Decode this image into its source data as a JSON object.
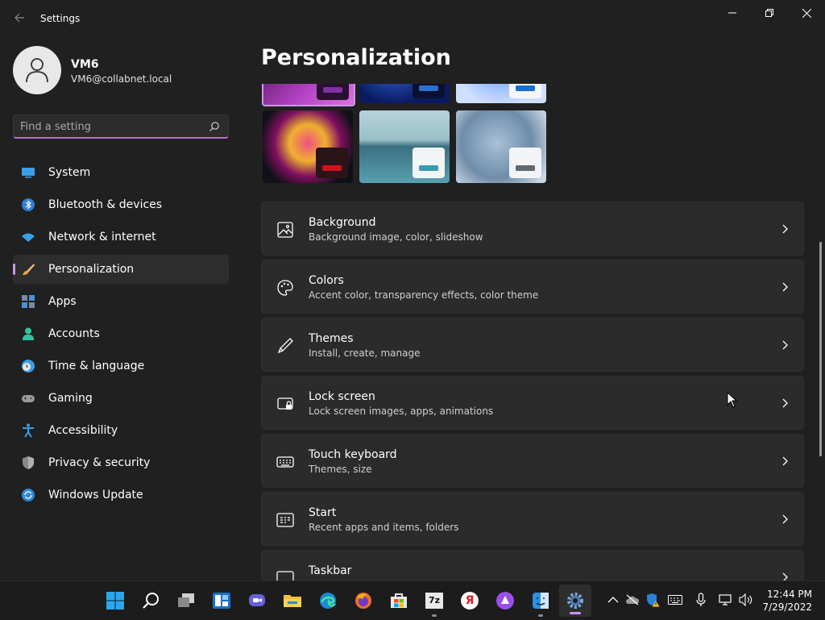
{
  "window": {
    "title": "Settings"
  },
  "user": {
    "name": "VM6",
    "email": "VM6@collabnet.local"
  },
  "search": {
    "placeholder": "Find a setting",
    "value": ""
  },
  "nav": {
    "items": [
      {
        "label": "System",
        "icon": "monitor-icon",
        "active": false
      },
      {
        "label": "Bluetooth & devices",
        "icon": "bluetooth-icon",
        "active": false
      },
      {
        "label": "Network & internet",
        "icon": "wifi-icon",
        "active": false
      },
      {
        "label": "Personalization",
        "icon": "brush-icon",
        "active": true
      },
      {
        "label": "Apps",
        "icon": "apps-icon",
        "active": false
      },
      {
        "label": "Accounts",
        "icon": "person-icon",
        "active": false
      },
      {
        "label": "Time & language",
        "icon": "clock-globe-icon",
        "active": false
      },
      {
        "label": "Gaming",
        "icon": "gamepad-icon",
        "active": false
      },
      {
        "label": "Accessibility",
        "icon": "accessibility-icon",
        "active": false
      },
      {
        "label": "Privacy & security",
        "icon": "shield-icon",
        "active": false
      },
      {
        "label": "Windows Update",
        "icon": "update-icon",
        "active": false
      }
    ]
  },
  "page": {
    "title": "Personalization"
  },
  "settings": [
    {
      "title": "Background",
      "subtitle": "Background image, color, slideshow",
      "icon": "picture-icon"
    },
    {
      "title": "Colors",
      "subtitle": "Accent color, transparency effects, color theme",
      "icon": "palette-icon"
    },
    {
      "title": "Themes",
      "subtitle": "Install, create, manage",
      "icon": "pen-icon"
    },
    {
      "title": "Lock screen",
      "subtitle": "Lock screen images, apps, animations",
      "icon": "lock-screen-icon"
    },
    {
      "title": "Touch keyboard",
      "subtitle": "Themes, size",
      "icon": "keyboard-icon"
    },
    {
      "title": "Start",
      "subtitle": "Recent apps and items, folders",
      "icon": "start-icon"
    },
    {
      "title": "Taskbar",
      "subtitle": "",
      "icon": "taskbar-icon"
    }
  ],
  "taskbar": {
    "apps": [
      "start-icon",
      "search-icon",
      "task-view-icon",
      "widgets-icon",
      "chat-icon",
      "file-explorer-icon",
      "edge-icon",
      "firefox-icon",
      "store-icon",
      "7zip-icon",
      "yandex-icon",
      "alice-icon",
      "finder-icon",
      "settings-icon"
    ],
    "app_label_7zip": "7z",
    "app_label_yandex": "Я",
    "clock": {
      "time": "12:44 PM",
      "date": "7/29/2022"
    }
  },
  "colors": {
    "accent": "#c69ae0",
    "background": "#202020",
    "card": "#2b2b2b",
    "taskbar": "#1c1c1c"
  }
}
